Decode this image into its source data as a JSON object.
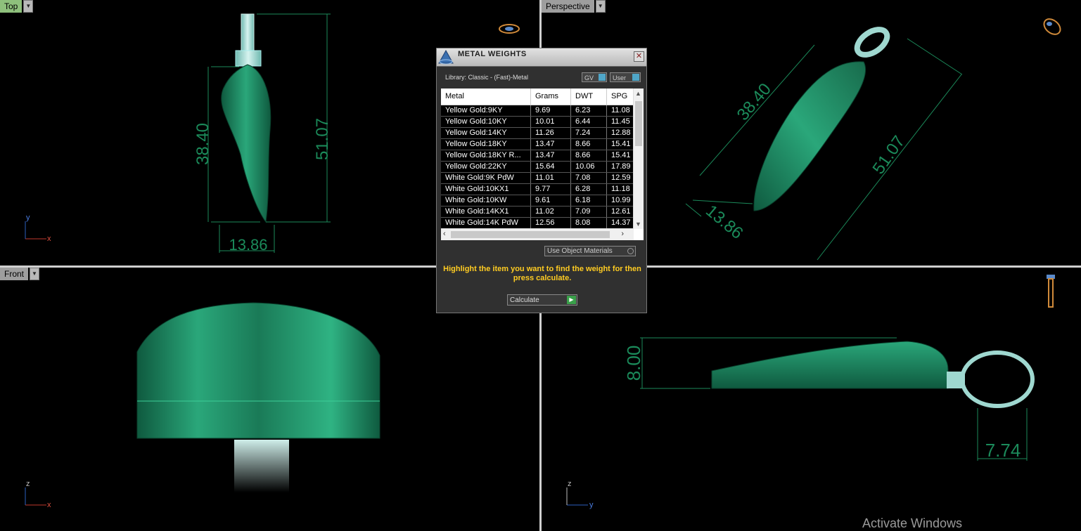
{
  "viewports": {
    "top": {
      "label": "Top",
      "axis_v": "y",
      "axis_h": "x",
      "dim_height": "51.07",
      "dim_body": "38.40",
      "dim_width": "13.86"
    },
    "perspective": {
      "label": "Perspective",
      "dim_a": "38.40",
      "dim_b": "51.07",
      "dim_c": "13.86"
    },
    "front": {
      "label": "Front",
      "axis_v": "z",
      "axis_h": "x"
    },
    "right": {
      "axis_v": "z",
      "axis_h": "y",
      "dim_height": "8.00",
      "dim_bail": "7.74"
    }
  },
  "dialog": {
    "title": "METAL WEIGHTS",
    "close": "✕",
    "library": "Library: Classic - (Fast)-Metal",
    "gv_label": "GV",
    "user_label": "User",
    "columns": [
      "Metal",
      "Grams",
      "DWT",
      "SPG"
    ],
    "rows": [
      [
        "Yellow Gold:9KY",
        "9.69",
        "6.23",
        "11.08"
      ],
      [
        "Yellow Gold:10KY",
        "10.01",
        "6.44",
        "11.45"
      ],
      [
        "Yellow Gold:14KY",
        "11.26",
        "7.24",
        "12.88"
      ],
      [
        "Yellow Gold:18KY",
        "13.47",
        "8.66",
        "15.41"
      ],
      [
        "Yellow Gold:18KY R...",
        "13.47",
        "8.66",
        "15.41"
      ],
      [
        "Yellow Gold:22KY",
        "15.64",
        "10.06",
        "17.89"
      ],
      [
        "White Gold:9K PdW",
        "11.01",
        "7.08",
        "12.59"
      ],
      [
        "White Gold:10KX1",
        "9.77",
        "6.28",
        "11.18"
      ],
      [
        "White Gold:10KW",
        "9.61",
        "6.18",
        "10.99"
      ],
      [
        "White Gold:14KX1",
        "11.02",
        "7.09",
        "12.61"
      ],
      [
        "White Gold:14K PdW",
        "12.56",
        "8.08",
        "14.37"
      ]
    ],
    "use_materials_label": "Use Object Materials",
    "hint": "Highlight the item you want to find the weight for then press calculate.",
    "calculate_label": "Calculate"
  },
  "watermark": "Activate Windows",
  "colors": {
    "model": "#1f8a63",
    "dimension": "#1b8a5a",
    "bail": "#9fd8d0",
    "hint": "#ffcc22"
  }
}
